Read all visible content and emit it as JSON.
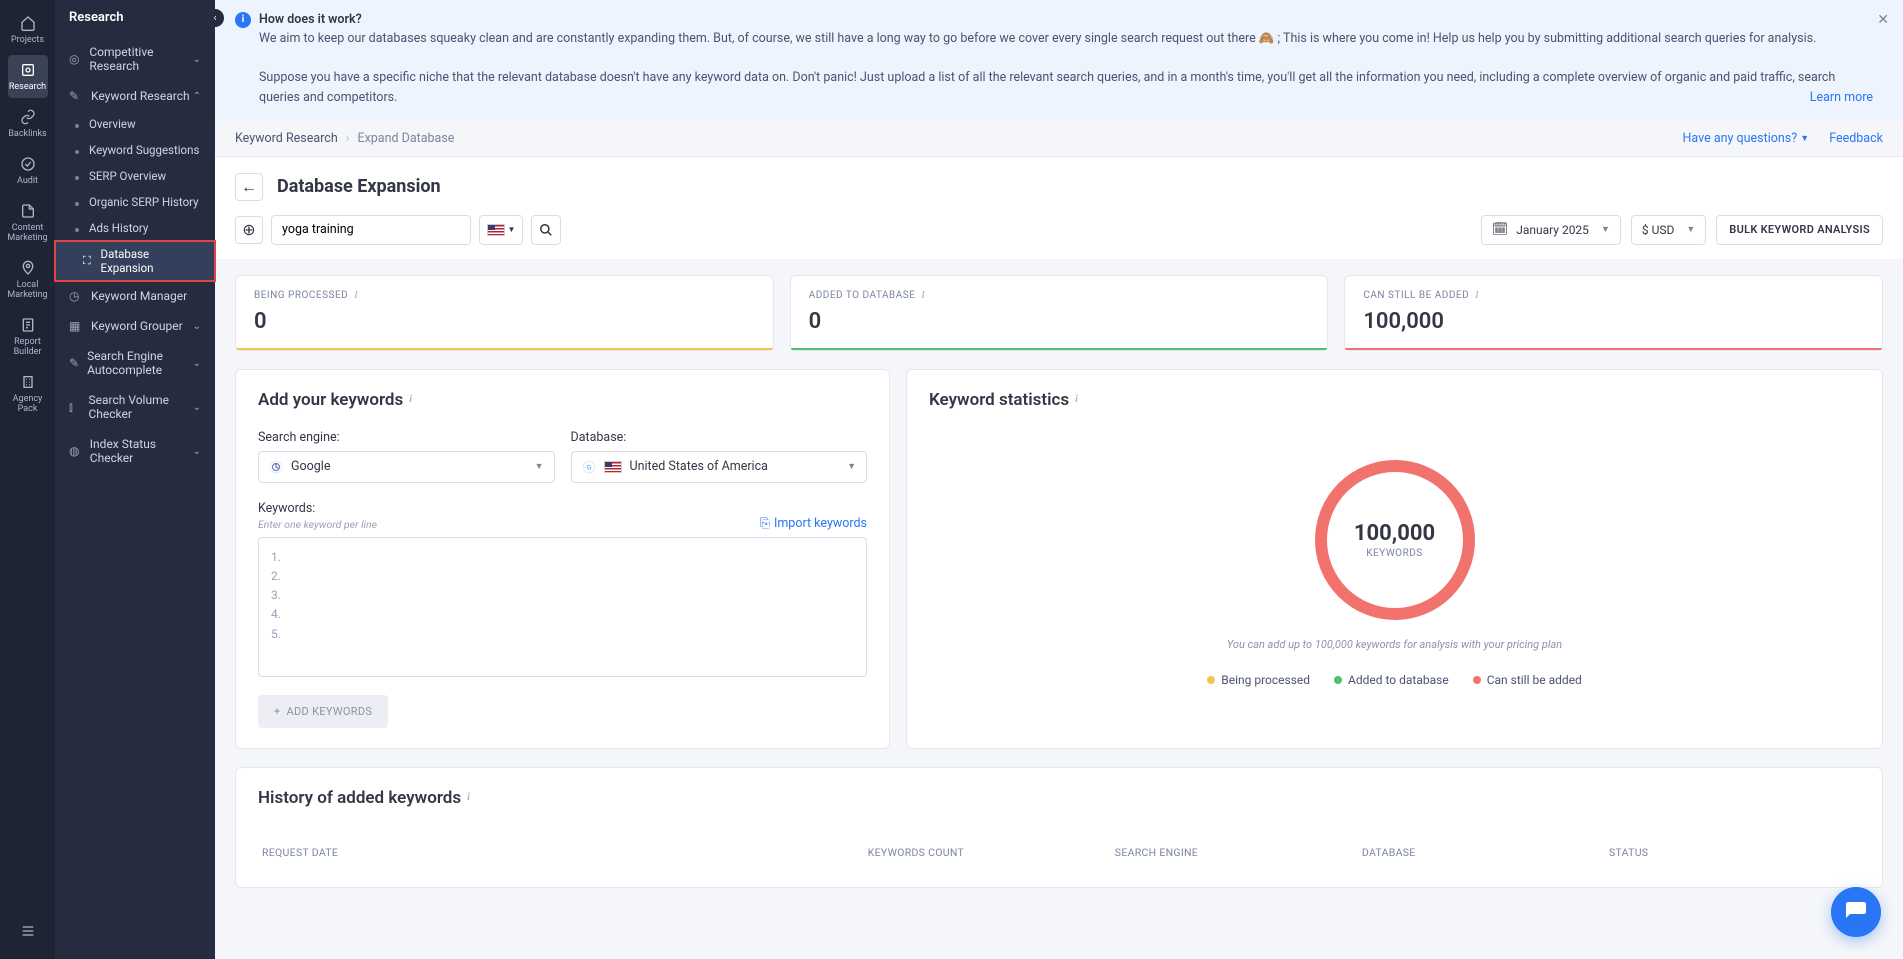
{
  "rail": {
    "items": [
      {
        "label": "Projects",
        "icon": "home"
      },
      {
        "label": "Research",
        "icon": "research",
        "active": true
      },
      {
        "label": "Backlinks",
        "icon": "link"
      },
      {
        "label": "Audit",
        "icon": "check"
      },
      {
        "label": "Content Marketing",
        "icon": "doc"
      },
      {
        "label": "Local Marketing",
        "icon": "pin"
      },
      {
        "label": "Report Builder",
        "icon": "report"
      },
      {
        "label": "Agency Pack",
        "icon": "agency"
      }
    ],
    "bottom": {
      "icon": "collapse"
    }
  },
  "sidebar": {
    "title": "Research",
    "groups": [
      {
        "label": "Competitive Research",
        "icon": "target",
        "expand": "down"
      },
      {
        "label": "Keyword Research",
        "icon": "kw",
        "expand": "up",
        "subs": [
          "Overview",
          "Keyword Suggestions",
          "SERP Overview",
          "Organic SERP History",
          "Ads History"
        ],
        "active_sub": {
          "label": "Database Expansion",
          "icon": "db"
        }
      },
      {
        "label": "Keyword Manager",
        "icon": "clock"
      },
      {
        "label": "Keyword Grouper",
        "icon": "group",
        "expand": "down"
      },
      {
        "label": "Search Engine Autocomplete",
        "icon": "auto",
        "expand": "down"
      },
      {
        "label": "Search Volume Checker",
        "icon": "vol",
        "expand": "down"
      },
      {
        "label": "Index Status Checker",
        "icon": "idx",
        "expand": "down"
      }
    ]
  },
  "banner": {
    "heading": "How does it work?",
    "p1": "We aim to keep our databases squeaky clean and are constantly expanding them. But, of course, we still have a long way to go before we cover every single search request out there 🙈 ; This is where you come in! Help us help you by submitting additional search queries for analysis.",
    "p2": "Suppose you have a specific niche that the relevant database doesn't have any keyword data on. Don't panic! Just upload a list of all the relevant search queries, and in a month's time, you'll get all the information you need, including a complete overview of organic and paid traffic, search queries and competitors.",
    "learn": "Learn more"
  },
  "crumbs": {
    "a": "Keyword Research",
    "b": "Expand Database",
    "haveq": "Have any questions?",
    "fbk": "Feedback"
  },
  "title": "Database Expansion",
  "toolbar": {
    "search_value": "yoga training",
    "month": "January 2025",
    "currency": "$ USD",
    "bulk": "BULK KEYWORD ANALYSIS"
  },
  "stats": {
    "processed": {
      "label": "BEING PROCESSED",
      "value": "0"
    },
    "added": {
      "label": "ADDED TO DATABASE",
      "value": "0"
    },
    "can": {
      "label": "CAN STILL BE ADDED",
      "value": "100,000"
    }
  },
  "add": {
    "heading": "Add your keywords",
    "se_label": "Search engine:",
    "se_value": "Google",
    "db_label": "Database:",
    "db_value": "United States of America",
    "kw_label": "Keywords:",
    "kw_hint": "Enter one keyword per line",
    "import": "Import keywords",
    "lines": [
      "1.",
      "2.",
      "3.",
      "4.",
      "5."
    ],
    "btn": "ADD KEYWORDS"
  },
  "kstat": {
    "heading": "Keyword statistics",
    "donut_value": "100,000",
    "donut_label": "KEYWORDS",
    "note": "You can add up to 100,000 keywords for analysis with your pricing plan",
    "legend": {
      "p": "Being processed",
      "a": "Added to database",
      "c": "Can still be added"
    }
  },
  "hist": {
    "heading": "History of added keywords",
    "cols": [
      "REQUEST DATE",
      "KEYWORDS COUNT",
      "SEARCH ENGINE",
      "DATABASE",
      "STATUS"
    ]
  }
}
